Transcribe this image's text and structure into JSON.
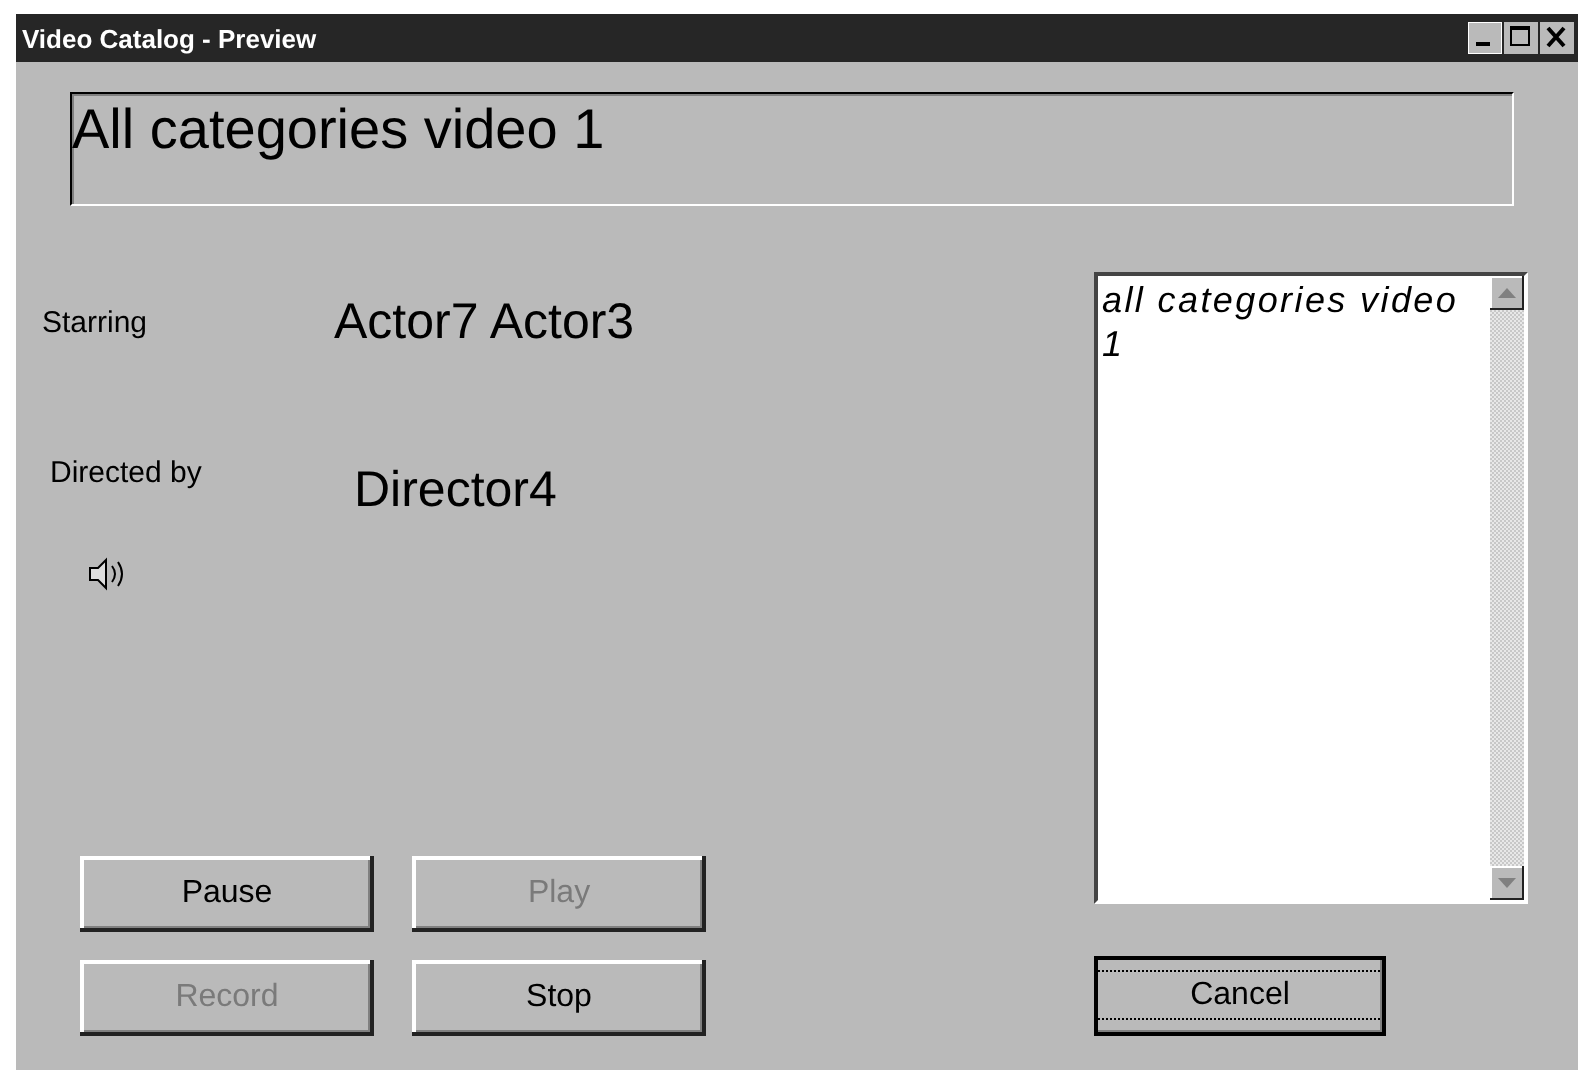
{
  "window": {
    "title": "Video Catalog - Preview"
  },
  "heading": {
    "value": "All categories video 1"
  },
  "details": [
    {
      "label": "Starring",
      "value": "Actor7 Actor3"
    },
    {
      "label": "Directed by",
      "value": "Director4"
    }
  ],
  "sound": {
    "kind": "speaker"
  },
  "media_buttons": [
    {
      "label": "Pause",
      "disabled": false
    },
    {
      "label": "Play",
      "disabled": true
    },
    {
      "label": "Record",
      "disabled": true
    },
    {
      "label": "Stop",
      "disabled": false
    }
  ],
  "list": {
    "items": [
      {
        "text": "all categories video 1",
        "selected": false
      }
    ]
  },
  "cancel_button": {
    "label": "Cancel",
    "focused": true
  }
}
